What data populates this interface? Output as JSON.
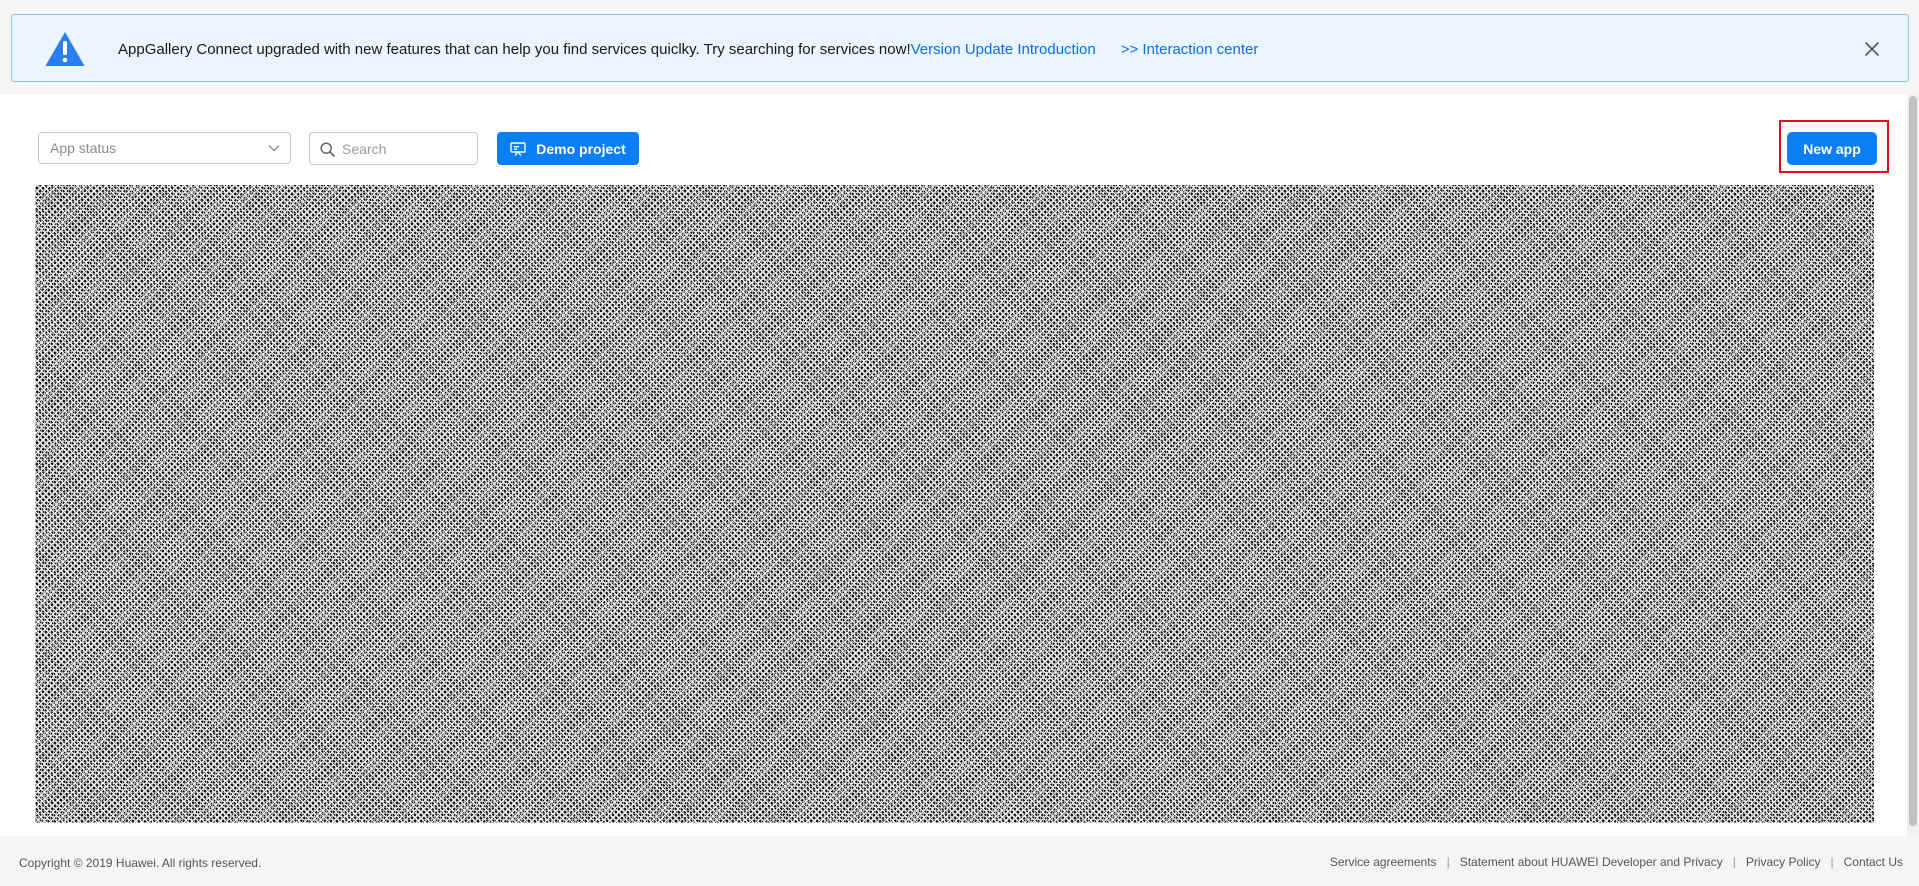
{
  "notice": {
    "message": "AppGallery Connect upgraded with new features that can help you find services quiclky. Try searching for services now!",
    "version_link": "Version Update Introduction",
    "interaction_link": ">> Interaction center",
    "icon": "warning-icon",
    "close_icon": "close-icon"
  },
  "toolbar": {
    "status_placeholder": "App status",
    "search_placeholder": "Search",
    "demo_label": "Demo project",
    "new_app_label": "New app"
  },
  "footer": {
    "copyright": "Copyright © 2019 Huawei. All rights reserved.",
    "links": [
      "Service agreements",
      "Statement about HUAWEI Developer and Privacy",
      "Privacy Policy",
      "Contact Us"
    ]
  },
  "colors": {
    "primary": "#0a7ff5",
    "link": "#0a6fe6",
    "notice_bg": "#ebf5ff",
    "highlight": "#e0101e"
  }
}
